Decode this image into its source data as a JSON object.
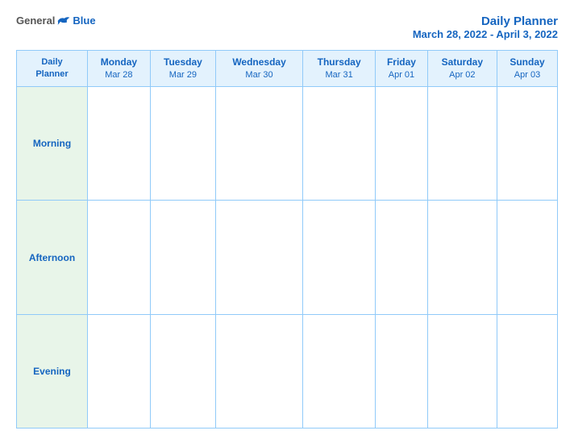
{
  "header": {
    "logo": {
      "general": "General",
      "blue": "Blue"
    },
    "title": "Daily Planner",
    "date_range": "March 28, 2022 - April 3, 2022"
  },
  "table": {
    "corner_label_line1": "Daily",
    "corner_label_line2": "Planner",
    "columns": [
      {
        "day": "Monday",
        "date": "Mar 28"
      },
      {
        "day": "Tuesday",
        "date": "Mar 29"
      },
      {
        "day": "Wednesday",
        "date": "Mar 30"
      },
      {
        "day": "Thursday",
        "date": "Mar 31"
      },
      {
        "day": "Friday",
        "date": "Apr 01"
      },
      {
        "day": "Saturday",
        "date": "Apr 02"
      },
      {
        "day": "Sunday",
        "date": "Apr 03"
      }
    ],
    "rows": [
      {
        "label": "Morning"
      },
      {
        "label": "Afternoon"
      },
      {
        "label": "Evening"
      }
    ]
  }
}
